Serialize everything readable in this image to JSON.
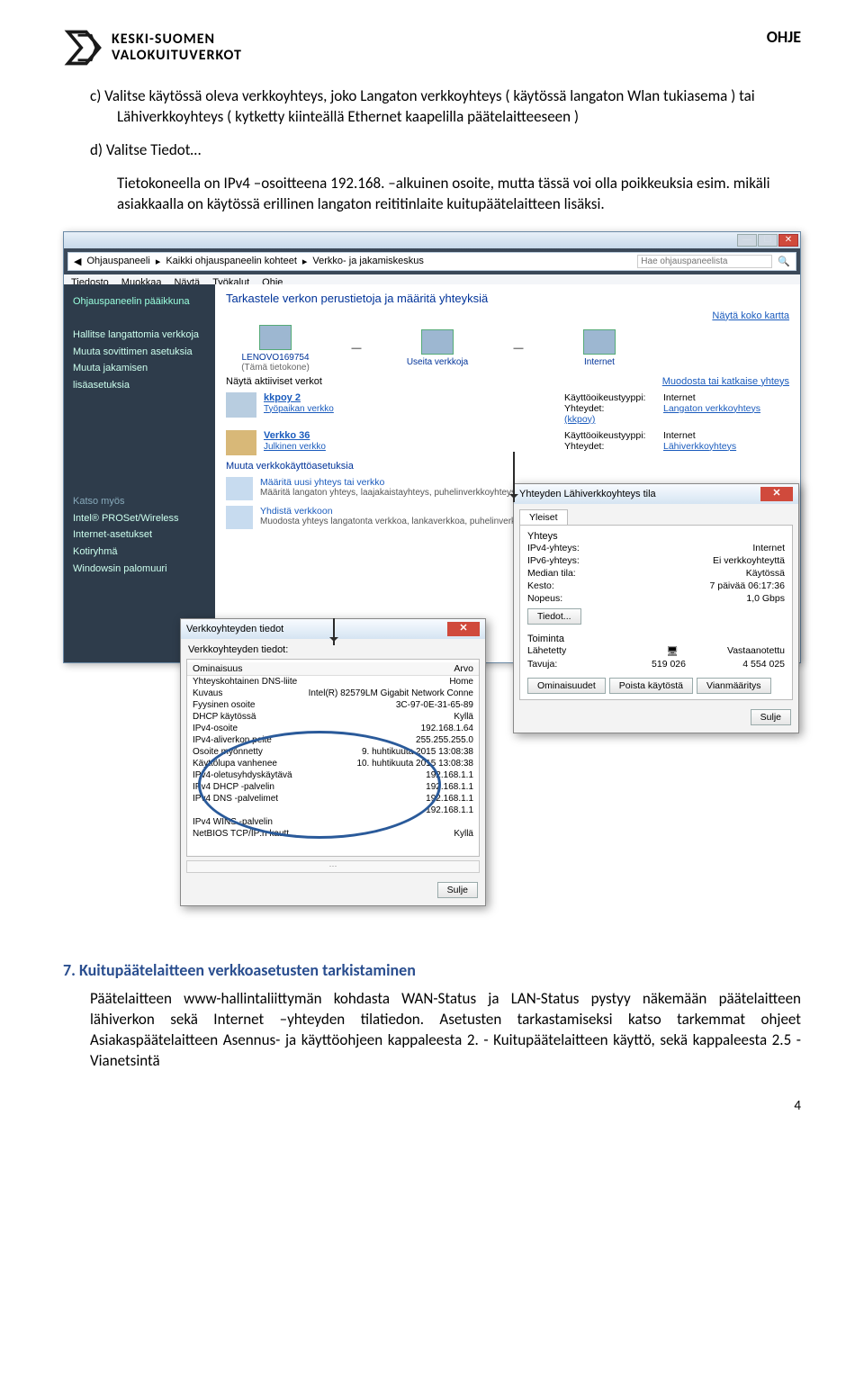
{
  "header": {
    "ohje": "OHJE",
    "logo_line1": "KESKI-SUOMEN",
    "logo_line2": "VALOKUITUVERKOT"
  },
  "body": {
    "item_c": "c)   Valitse käytössä oleva verkkoyhteys, joko Langaton verkkoyhteys ( käytössä langaton Wlan tukiasema ) tai Lähiverkkoyhteys ( kytketty kiinteällä Ethernet kaapelilla päätelaitteeseen )",
    "item_d": "d)   Valitse Tiedot…",
    "para": "Tietokoneella on IPv4 –osoitteena 192.168. –alkuinen osoite, mutta tässä voi olla poikkeuksia esim. mikäli asiakkaalla on käytössä erillinen langaton reititinlaite kuitupäätelaitteen lisäksi."
  },
  "win_main": {
    "crumbs": [
      "Ohjauspaneeli",
      "Kaikki ohjauspaneelin kohteet",
      "Verkko- ja jakamiskeskus"
    ],
    "search_ph": "Hae ohjauspaneelista",
    "menus": [
      "Tiedosto",
      "Muokkaa",
      "Näytä",
      "Työkalut",
      "Ohje"
    ],
    "sidebar_top_title": "Ohjauspaneelin pääikkuna",
    "sidebar_top": [
      "Hallitse langattomia verkkoja",
      "Muuta sovittimen asetuksia",
      "Muuta jakamisen lisäasetuksia"
    ],
    "sidebar_bottom_title": "Katso myös",
    "sidebar_bottom": [
      "Intel® PROSet/Wireless",
      "Internet-asetukset",
      "Kotiryhmä",
      "Windowsin palomuuri"
    ],
    "main_title": "Tarkastele verkon perustietoja ja määritä yhteyksiä",
    "show_map": "Näytä koko kartta",
    "dev1": "LENOVO169754",
    "dev1_sub": "(Tämä tietokone)",
    "dev2": "Useita verkkoja",
    "dev3": "Internet",
    "active_label": "Näytä aktiiviset verkot",
    "conn_link": "Muodosta tai katkaise yhteys",
    "net1": {
      "name": "kkpoy 2",
      "type": "Työpaikan verkko",
      "k1": "Käyttöoikeustyyppi:",
      "v1": "Internet",
      "k2": "Yhteydet:",
      "v2": "Langaton verkkoyhteys (kkpoy)"
    },
    "net2": {
      "name": "Verkko 36",
      "type": "Julkinen verkko",
      "k1": "Käyttöoikeustyyppi:",
      "v1": "Internet",
      "k2": "Yhteydet:",
      "v2": "Lähiverkkoyhteys"
    },
    "change_label": "Muuta verkkokäyttöasetuksia",
    "task1_t": "Määritä uusi yhteys tai verkko",
    "task1_d": "Määritä langaton yhteys, laajakaistayhteys, puhelinverkkoyhteys, tiet VPN-yhteys, reititin tai tukiasema.",
    "task2_t": "Yhdistä verkkoon",
    "task2_d": "Muodosta yhteys langatonta verkkoa, lankaverkkoa, puhelinverkkoyhteyteen tai muodosta yhteys uudelleen."
  },
  "dlg_status": {
    "title": "Yhteyden Lähiverkkoyhteys tila",
    "tab": "Yleiset",
    "group_conn": "Yhteys",
    "rows": [
      {
        "k": "IPv4-yhteys:",
        "v": "Internet"
      },
      {
        "k": "IPv6-yhteys:",
        "v": "Ei verkkoyhteyttä"
      },
      {
        "k": "Median tila:",
        "v": "Käytössä"
      },
      {
        "k": "Kesto:",
        "v": "7 päivää 06:17:36"
      },
      {
        "k": "Nopeus:",
        "v": "1,0 Gbps"
      }
    ],
    "btn_details": "Tiedot...",
    "group_act": "Toiminta",
    "sent": "Lähetetty",
    "recv": "Vastaanotettu",
    "bytes_k": "Tavuja:",
    "bytes_s": "519 026",
    "bytes_r": "4 554 025",
    "btn_props": "Ominaisuudet",
    "btn_disable": "Poista käytöstä",
    "btn_diag": "Vianmääritys",
    "btn_close": "Sulje"
  },
  "dlg_details": {
    "title": "Verkkoyhteyden tiedot",
    "label": "Verkkoyhteyden tiedot:",
    "hdr_prop": "Ominaisuus",
    "hdr_val": "Arvo",
    "rows": [
      {
        "k": "Yhteyskohtainen DNS-liite",
        "v": "Home"
      },
      {
        "k": "Kuvaus",
        "v": "Intel(R) 82579LM Gigabit Network Conne"
      },
      {
        "k": "Fyysinen osoite",
        "v": "3C-97-0E-31-65-89"
      },
      {
        "k": "DHCP käytössä",
        "v": "Kyllä"
      },
      {
        "k": "IPv4-osoite",
        "v": "192.168.1.64"
      },
      {
        "k": "IPv4-aliverkon peite",
        "v": "255.255.255.0"
      },
      {
        "k": "Osoite myönnetty",
        "v": "9. huhtikuuta 2015 13:08:38"
      },
      {
        "k": "Käyttölupa vanhenee",
        "v": "10. huhtikuuta 2015 13:08:38"
      },
      {
        "k": "IPv4-oletusyhdyskäytävä",
        "v": "192.168.1.1"
      },
      {
        "k": "IPv4 DHCP -palvelin",
        "v": "192.168.1.1"
      },
      {
        "k": "IPv4 DNS -palvelimet",
        "v": "192.168.1.1"
      },
      {
        "k": "",
        "v": "192.168.1.1"
      },
      {
        "k": "IPv4 WINS -palvelin",
        "v": ""
      },
      {
        "k": "NetBIOS TCP/IP:n kautt...",
        "v": "Kyllä"
      }
    ],
    "btn_close": "Sulje"
  },
  "section7": {
    "title": "7.   Kuitupäätelaitteen verkkoasetusten tarkistaminen",
    "para1": "Päätelaitteen www-hallintaliittymän kohdasta WAN-Status ja LAN-Status  pystyy näkemään päätelaitteen lähiverkon sekä Internet –yhteyden tilatiedon. Asetusten tarkastamiseksi katso tarkemmat ohjeet Asiakaspäätelaitteen Asennus- ja käyttöohjeen kappaleesta 2. - Kuitupäätelaitteen käyttö, sekä kappaleesta 2.5 - Vianetsintä"
  },
  "pagenum": "4"
}
